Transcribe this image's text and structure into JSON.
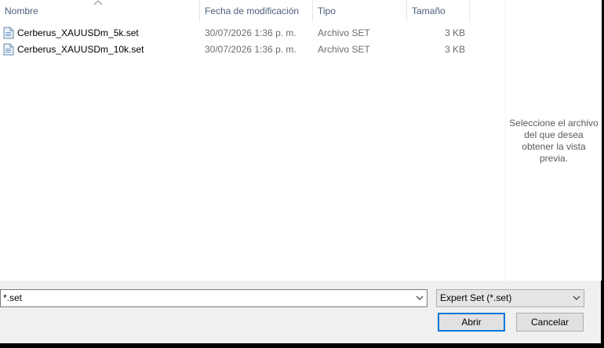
{
  "columns": {
    "name": "Nombre",
    "modified": "Fecha de modificación",
    "type": "Tipo",
    "size": "Tamaño"
  },
  "files": [
    {
      "name": "Cerberus_XAUUSDm_5k.set",
      "modified": "30/07/2026 1:36 p. m.",
      "type": "Archivo SET",
      "size": "3 KB"
    },
    {
      "name": "Cerberus_XAUUSDm_10k.set",
      "modified": "30/07/2026 1:36 p. m.",
      "type": "Archivo SET",
      "size": "3 KB"
    }
  ],
  "preview": {
    "line1": "Seleccione el archivo",
    "line2": "del que desea",
    "line3": "obtener la vista",
    "line4": "previa."
  },
  "filename_field": {
    "value": "*.set"
  },
  "filetype_select": {
    "value": "Expert Set (*.set)"
  },
  "buttons": {
    "open": "Abrir",
    "cancel": "Cancelar"
  },
  "icons": {
    "file": "set-file-icon",
    "sort": "sort-ascending-icon",
    "dropdown": "chevron-down-icon"
  }
}
